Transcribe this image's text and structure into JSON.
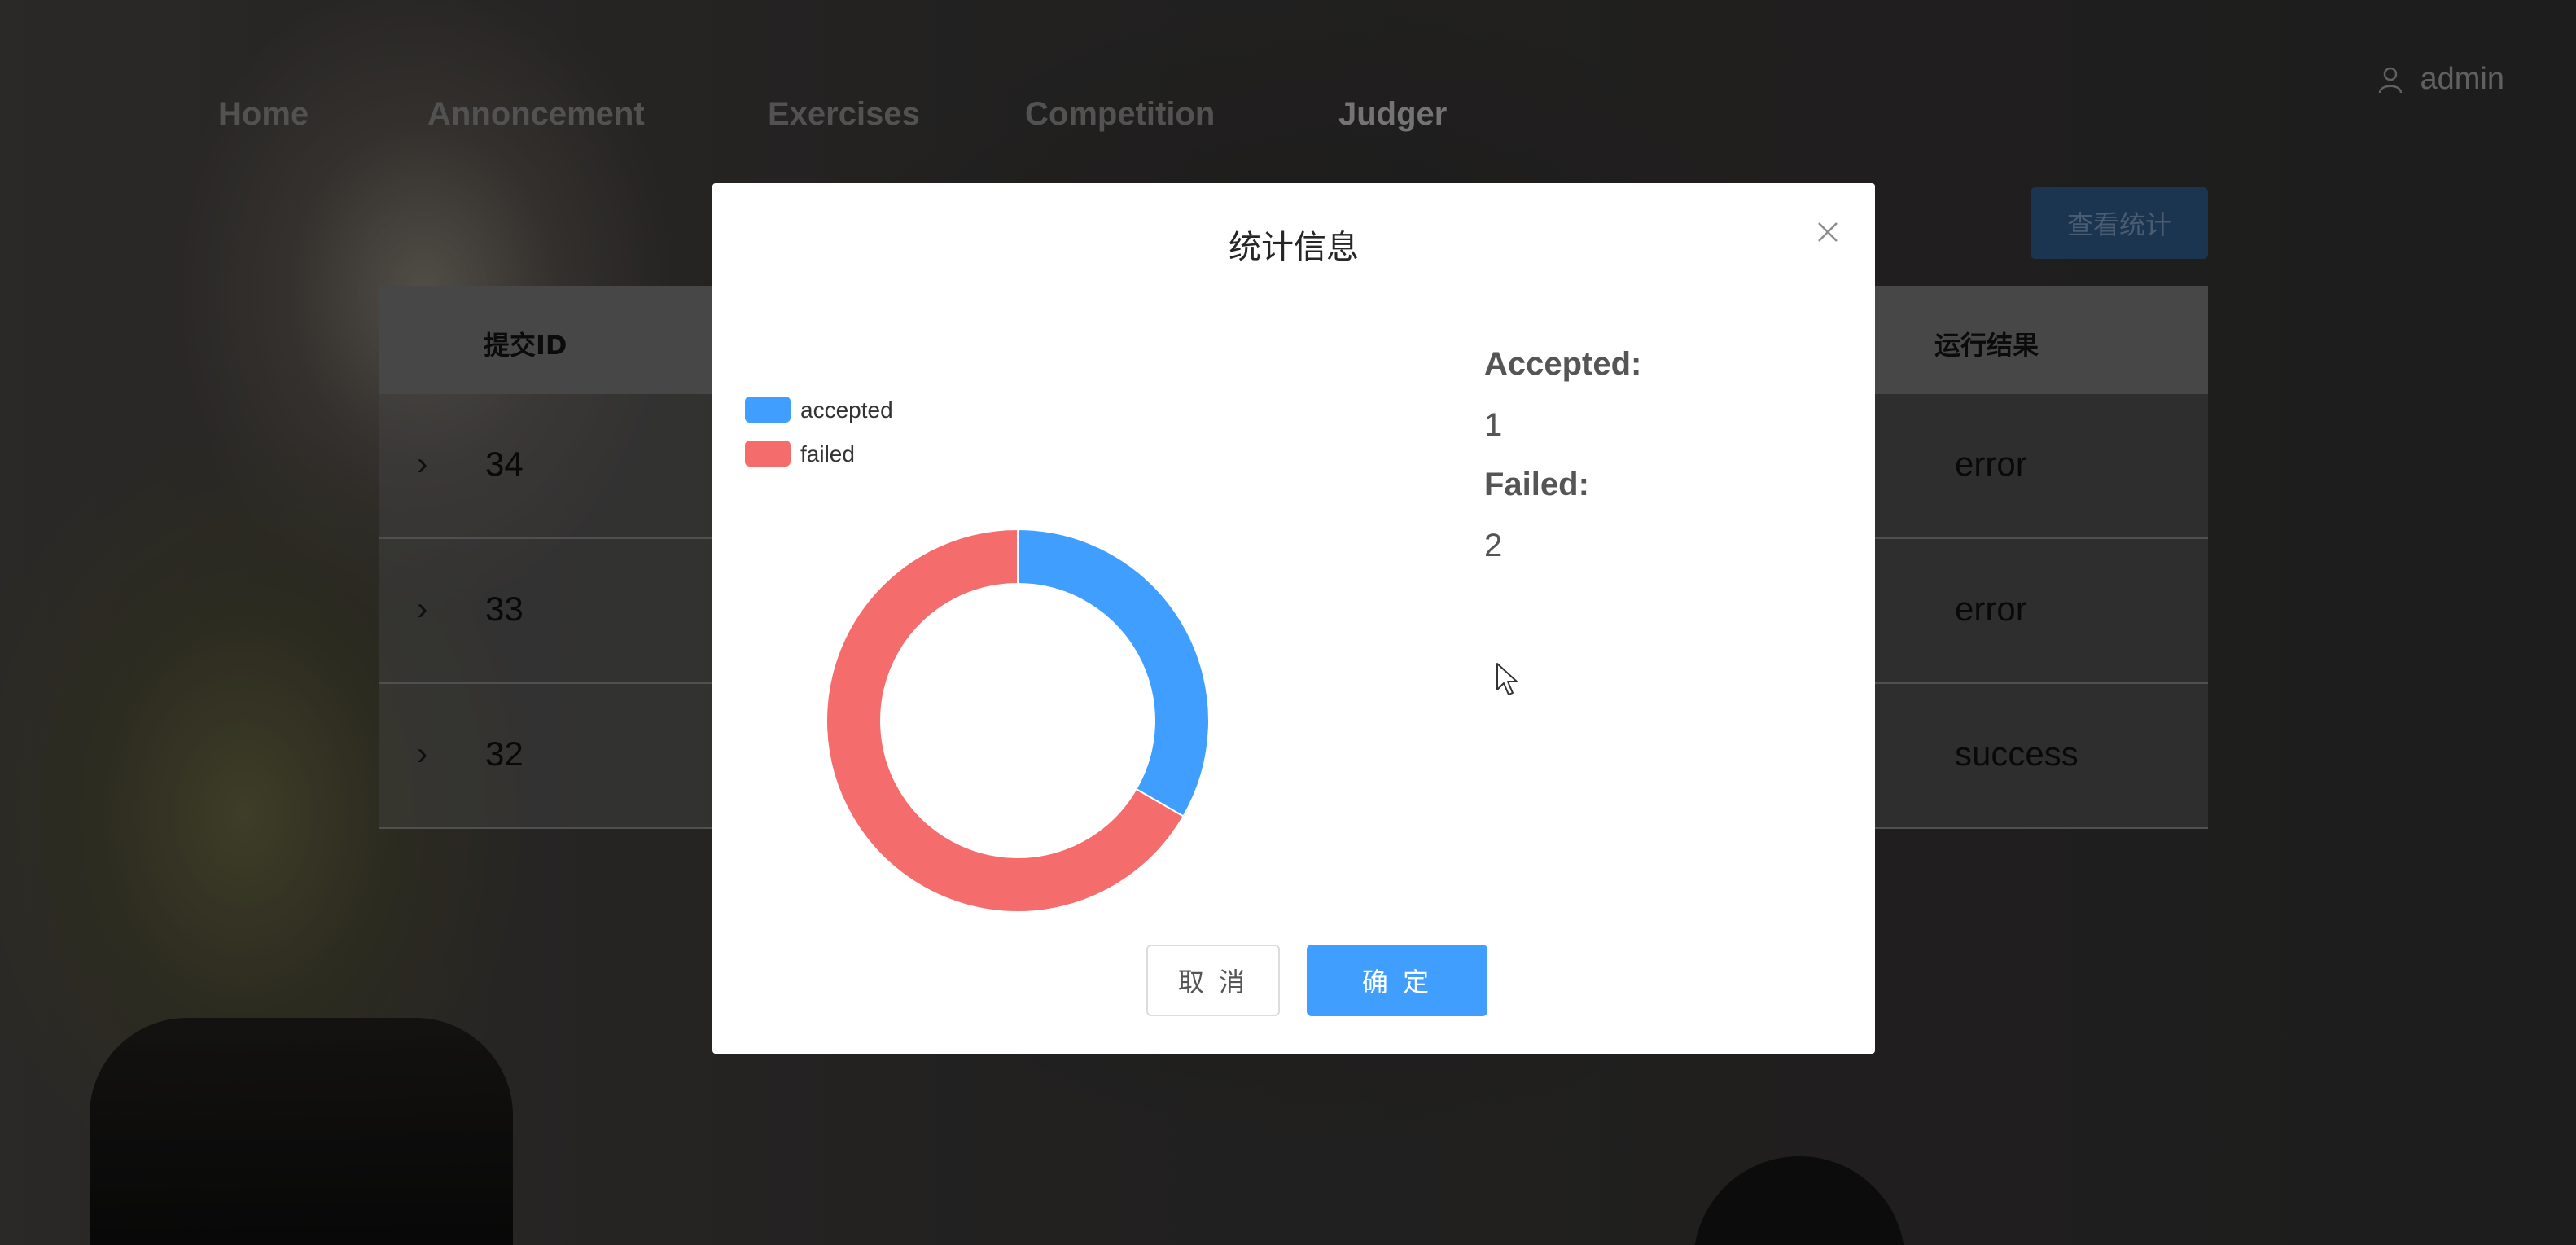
{
  "nav": {
    "items": [
      {
        "label": "Home"
      },
      {
        "label": "Annoncement"
      },
      {
        "label": "Exercises"
      },
      {
        "label": "Competition"
      },
      {
        "label": "Judger",
        "active": true
      }
    ],
    "user": {
      "name": "admin",
      "icon": "user-icon"
    }
  },
  "toolbar": {
    "stats_button": "查看统计"
  },
  "table": {
    "columns": [
      "提交ID",
      "运行结果"
    ],
    "rows": [
      {
        "id": "34",
        "result": "error"
      },
      {
        "id": "33",
        "result": "error"
      },
      {
        "id": "32",
        "result": "success"
      }
    ]
  },
  "modal": {
    "title": "统计信息",
    "accepted_label": "Accepted:",
    "accepted_value": "1",
    "failed_label": "Failed:",
    "failed_value": "2",
    "cancel_label": "取 消",
    "ok_label": "确 定"
  },
  "chart_data": {
    "type": "pie",
    "style": "donut",
    "categories": [
      "accepted",
      "failed"
    ],
    "values": [
      1,
      2
    ],
    "colors": [
      "#409eff",
      "#f56c6c"
    ],
    "legend": "top-left"
  },
  "colors": {
    "primary": "#409eff",
    "danger": "#f56c6c"
  }
}
